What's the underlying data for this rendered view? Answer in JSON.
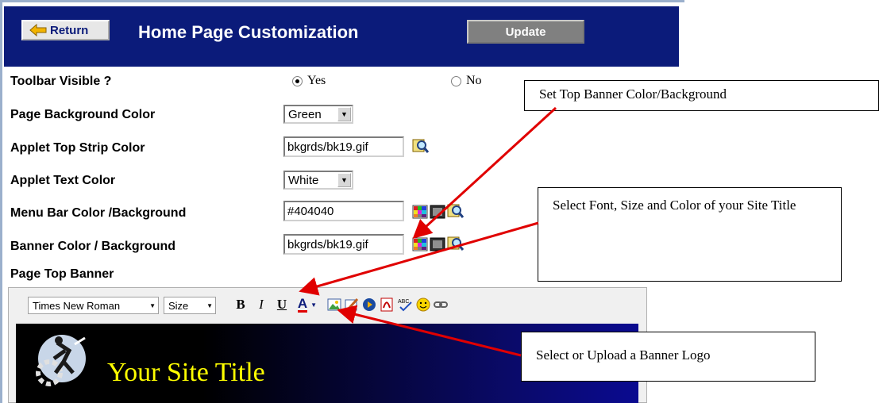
{
  "header": {
    "return_label": "Return",
    "title": "Home Page Customization",
    "update_label": "Update"
  },
  "rows": {
    "toolbar_visible": {
      "label": "Toolbar Visible ?",
      "yes": "Yes",
      "no": "No",
      "selected": "Yes"
    },
    "page_bg": {
      "label": "Page Background Color",
      "value": "Green"
    },
    "applet_strip": {
      "label": "Applet Top Strip Color",
      "value": "bkgrds/bk19.gif"
    },
    "applet_text": {
      "label": "Applet Text Color",
      "value": "White"
    },
    "menu_bar": {
      "label": "Menu Bar Color /Background",
      "value": "#404040"
    },
    "banner_color": {
      "label": "Banner Color / Background",
      "value": "bkgrds/bk19.gif"
    },
    "page_top_banner": {
      "label": "Page Top Banner"
    }
  },
  "editor": {
    "font_select": "Times New Roman",
    "size_select": "Size",
    "bold": "B",
    "italic": "I",
    "underline": "U",
    "font_color": "A",
    "banner_title": "Your Site Title"
  },
  "callouts": {
    "top_banner": "Set Top Banner Color/Background",
    "font": "Select Font, Size and Color of your Site Title",
    "logo": "Select or Upload a Banner Logo"
  },
  "icons": [
    "return-arrow-icon",
    "palette-icon",
    "image-picker-icon",
    "search-icon",
    "insert-image-icon",
    "edit-image-icon",
    "media-icon",
    "pdf-icon",
    "spellcheck-icon",
    "smiley-icon",
    "link-icon",
    "banner-logo-icon"
  ],
  "colors": {
    "header_bg": "#0b1b7a",
    "banner_text": "#ffff00",
    "arrow": "#e00000"
  }
}
